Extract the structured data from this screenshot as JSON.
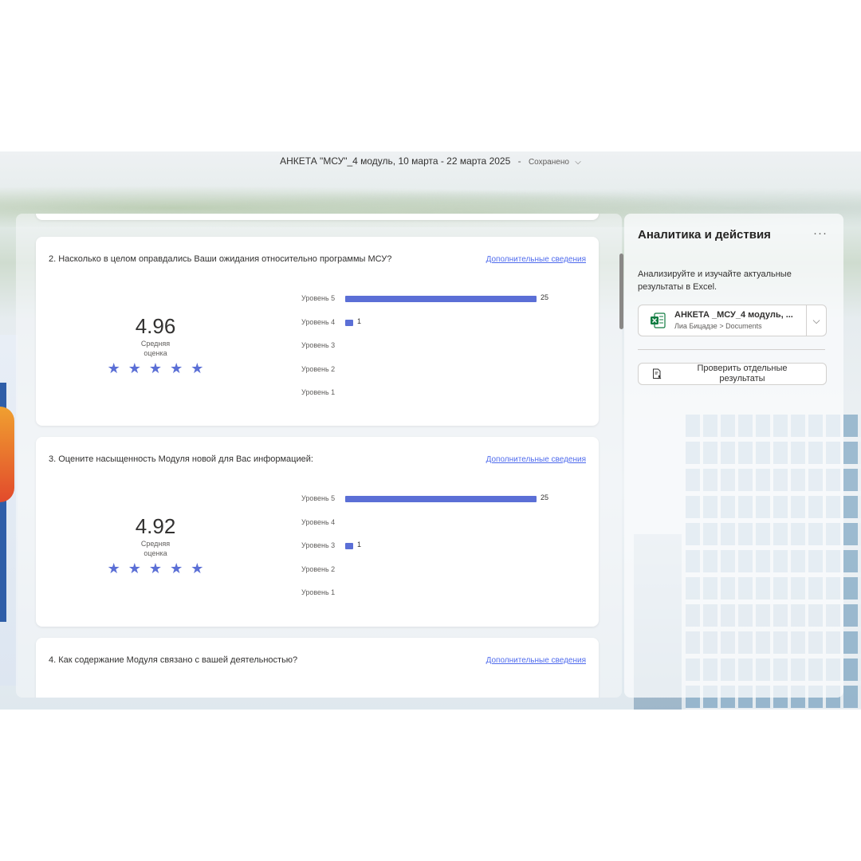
{
  "header": {
    "doc_title": "АНКЕТА \"МСУ\"_4 модуль, 10 марта - 22 марта 2025",
    "separator": "-",
    "status": "Сохранено",
    "chevron_icon": "chevron-down-icon"
  },
  "questions": [
    {
      "title": "2. Насколько в целом оправдались Ваши ожидания относительно программы МСУ?",
      "more_link": "Дополнительные сведения",
      "average": "4.96",
      "average_label": "Средняя оценка",
      "stars": 5,
      "levels": [
        {
          "label": "Уровень 5",
          "count": "25",
          "value": 25
        },
        {
          "label": "Уровень 4",
          "count": "1",
          "value": 1
        },
        {
          "label": "Уровень 3",
          "count": "",
          "value": 0
        },
        {
          "label": "Уровень 2",
          "count": "",
          "value": 0
        },
        {
          "label": "Уровень 1",
          "count": "",
          "value": 0
        }
      ]
    },
    {
      "title": "3. Оцените насыщенность Модуля новой для Вас информацией:",
      "more_link": "Дополнительные сведения",
      "average": "4.92",
      "average_label": "Средняя оценка",
      "stars": 5,
      "levels": [
        {
          "label": "Уровень 5",
          "count": "25",
          "value": 25
        },
        {
          "label": "Уровень 4",
          "count": "",
          "value": 0
        },
        {
          "label": "Уровень 3",
          "count": "1",
          "value": 1
        },
        {
          "label": "Уровень 2",
          "count": "",
          "value": 0
        },
        {
          "label": "Уровень 1",
          "count": "",
          "value": 0
        }
      ]
    },
    {
      "title": "4. Как содержание Модуля связано с вашей деятельностью?",
      "more_link": "Дополнительные сведения"
    }
  ],
  "side_panel": {
    "title": "Аналитика и действия",
    "more_icon": "···",
    "description": "Анализируйте и изучайте актуальные результаты в Excel.",
    "file": {
      "name": "АНКЕТА _МСУ_4 модуль, ...",
      "path": "Лиа Бицадзе > Documents",
      "dropdown_icon": "⌵"
    },
    "review_button": "Проверить отдельные результаты"
  },
  "colors": {
    "accent": "#5b6fd6",
    "link": "#4f6bed",
    "excel_green": "#107c41"
  }
}
